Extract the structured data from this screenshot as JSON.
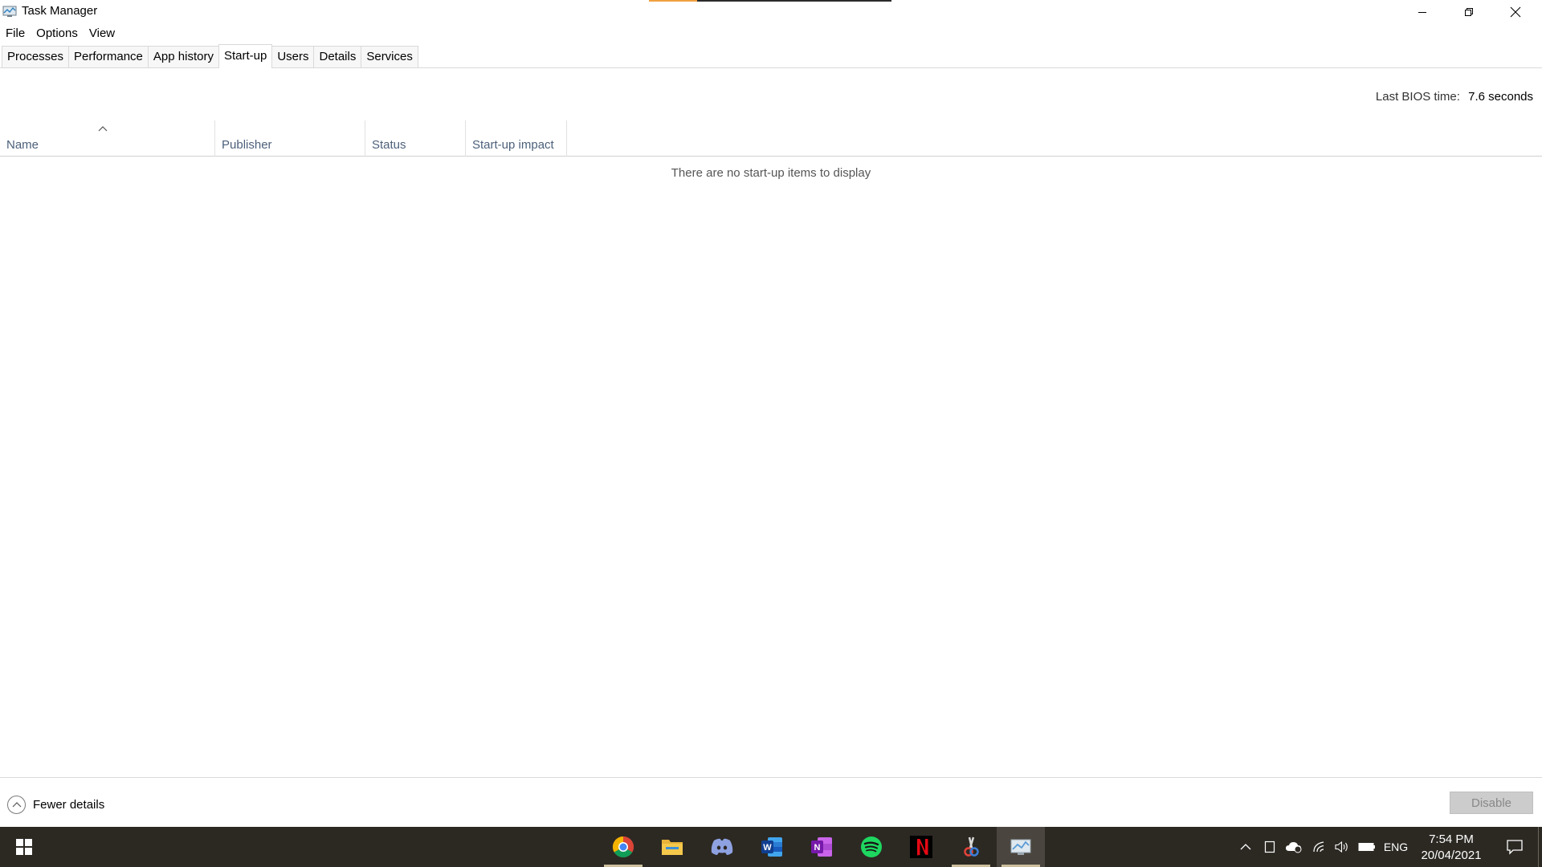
{
  "window": {
    "title": "Task Manager"
  },
  "menu": {
    "items": [
      "File",
      "Options",
      "View"
    ]
  },
  "tabs": {
    "items": [
      "Processes",
      "Performance",
      "App history",
      "Start-up",
      "Users",
      "Details",
      "Services"
    ],
    "active": "Start-up"
  },
  "bios": {
    "label": "Last BIOS time:",
    "value": "7.6 seconds"
  },
  "table": {
    "columns": [
      "Name",
      "Publisher",
      "Status",
      "Start-up impact"
    ],
    "sorted_column": "Name",
    "sort_direction": "ascending",
    "empty_message": "There are no start-up items to display"
  },
  "footer": {
    "fewer_details_label": "Fewer details",
    "disable_label": "Disable"
  },
  "taskbar": {
    "apps": [
      {
        "name": "chrome-icon",
        "running": true
      },
      {
        "name": "file-explorer-icon",
        "running": false
      },
      {
        "name": "discord-icon",
        "running": false
      },
      {
        "name": "word-icon",
        "running": false
      },
      {
        "name": "onenote-icon",
        "running": false
      },
      {
        "name": "spotify-icon",
        "running": false
      },
      {
        "name": "netflix-icon",
        "running": false
      },
      {
        "name": "snipping-tool-icon",
        "running": true
      },
      {
        "name": "task-manager-icon",
        "running": true,
        "active": true
      }
    ],
    "language": "ENG",
    "time": "7:54 PM",
    "date": "20/04/2021"
  },
  "colors": {
    "taskbar_bg": "#2c2923",
    "header_text": "#4c607a",
    "disabled_button": "#cccccc"
  }
}
